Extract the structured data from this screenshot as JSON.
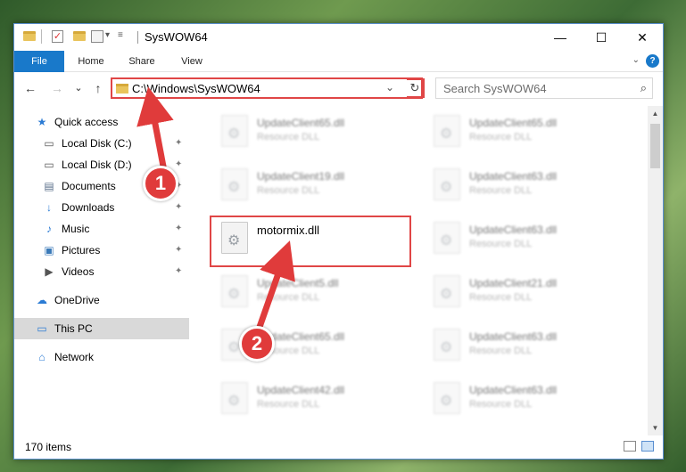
{
  "window": {
    "title": "SysWOW64",
    "controls": {
      "minimize": "—",
      "maximize": "☐",
      "close": "✕"
    }
  },
  "ribbon": {
    "tabs": [
      "File",
      "Home",
      "Share",
      "View"
    ],
    "help": "?"
  },
  "nav": {
    "back": "←",
    "forward": "→",
    "recent": "⌄",
    "up": "↑",
    "address": "C:\\Windows\\SysWOW64",
    "refresh": "↻",
    "search_placeholder": "Search SysWOW64",
    "search_icon": "⌕"
  },
  "sidebar": {
    "items": [
      {
        "label": "Quick access",
        "icon": "★",
        "pinned": false
      },
      {
        "label": "Local Disk (C:)",
        "icon": "▭",
        "pinned": true
      },
      {
        "label": "Local Disk (D:)",
        "icon": "▭",
        "pinned": true
      },
      {
        "label": "Documents",
        "icon": "▤",
        "pinned": true
      },
      {
        "label": "Downloads",
        "icon": "↓",
        "pinned": true
      },
      {
        "label": "Music",
        "icon": "♪",
        "pinned": true
      },
      {
        "label": "Pictures",
        "icon": "▣",
        "pinned": true
      },
      {
        "label": "Videos",
        "icon": "▶",
        "pinned": true
      },
      {
        "label": "OneDrive",
        "icon": "☁",
        "pinned": false
      },
      {
        "label": "This PC",
        "icon": "▭",
        "pinned": false
      },
      {
        "label": "Network",
        "icon": "⌂",
        "pinned": false
      }
    ],
    "pin_glyph": "✦"
  },
  "files": {
    "col1": [
      {
        "name": "UpdateClient65.dll",
        "type": "Resource DLL"
      },
      {
        "name": "UpdateClient19.dll",
        "type": "Resource DLL"
      },
      {
        "name": "motormix.dll",
        "type": ""
      },
      {
        "name": "UpdateClient5.dll",
        "type": "Resource DLL"
      },
      {
        "name": "UpdateClient65.dll",
        "type": "Resource DLL"
      },
      {
        "name": "UpdateClient42.dll",
        "type": "Resource DLL"
      }
    ],
    "col2": [
      {
        "name": "UpdateClient65.dll",
        "type": "Resource DLL"
      },
      {
        "name": "UpdateClient63.dll",
        "type": "Resource DLL"
      },
      {
        "name": "UpdateClient63.dll",
        "type": "Resource DLL"
      },
      {
        "name": "UpdateClient21.dll",
        "type": "Resource DLL"
      },
      {
        "name": "UpdateClient63.dll",
        "type": "Resource DLL"
      },
      {
        "name": "UpdateClient63.dll",
        "type": "Resource DLL"
      }
    ]
  },
  "status": {
    "item_count": "170 items"
  },
  "annotations": {
    "step1": "1",
    "step2": "2",
    "color": "#e03b3b"
  }
}
